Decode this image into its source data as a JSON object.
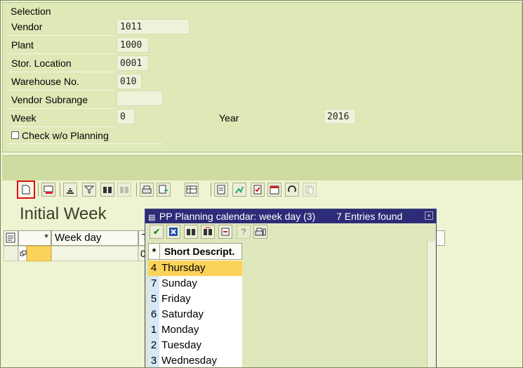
{
  "selection": {
    "title": "Selection",
    "vendor_label": "Vendor",
    "vendor_value": "1011",
    "plant_label": "Plant",
    "plant_value": "1000",
    "storloc_label": "Stor. Location",
    "storloc_value": "0001",
    "warehouse_label": "Warehouse No.",
    "warehouse_value": "010",
    "subrange_label": "Vendor Subrange",
    "subrange_value": "",
    "week_label": "Week",
    "week_value": "0",
    "year_label": "Year",
    "year_value": "2016",
    "check_label": "Check w/o Planning"
  },
  "heading": "Initial Week",
  "table": {
    "col_star": "*",
    "col_weekday": "Week day",
    "col_t": "T",
    "cell_zero": "0"
  },
  "dialog": {
    "title": "PP Planning calendar: week day (3)",
    "count": "7 Entries found",
    "column_star": "*",
    "column_label": "Short Descript.",
    "items": [
      {
        "num": "4",
        "label": "Thursday"
      },
      {
        "num": "7",
        "label": "Sunday"
      },
      {
        "num": "5",
        "label": "Friday"
      },
      {
        "num": "6",
        "label": "Saturday"
      },
      {
        "num": "1",
        "label": "Monday"
      },
      {
        "num": "2",
        "label": "Tuesday"
      },
      {
        "num": "3",
        "label": "Wednesday"
      }
    ],
    "selected_index": 0
  },
  "colors": {
    "dialog_title_bg": "#2c2c78",
    "selection_highlight": "#fcd35a",
    "new_button_outline": "#e01010"
  }
}
